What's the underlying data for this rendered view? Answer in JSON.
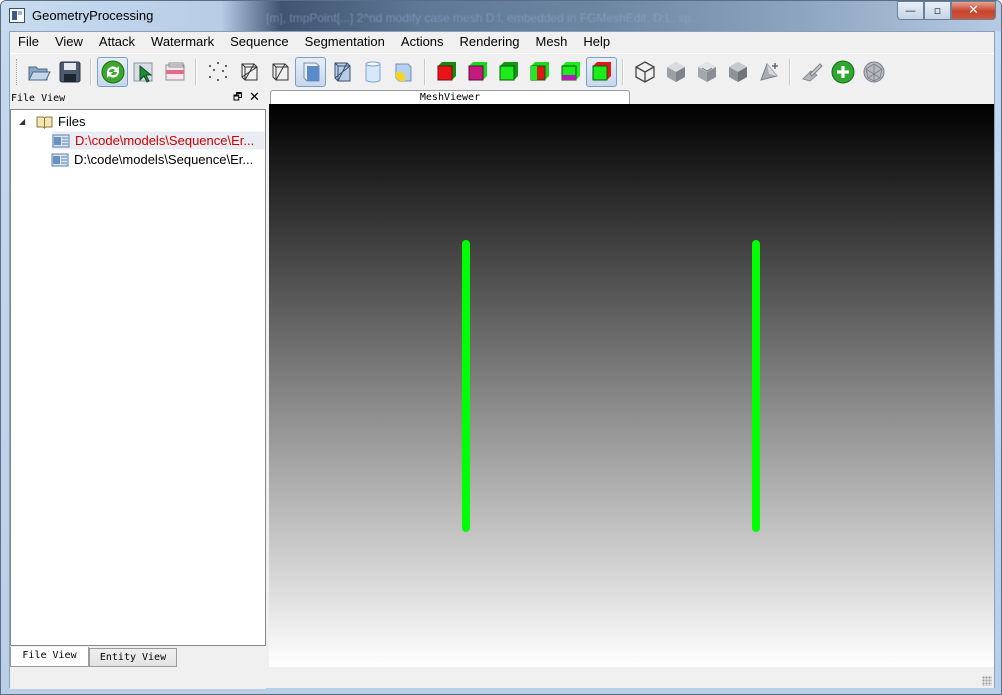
{
  "window": {
    "title": "GeometryProcessing",
    "background_text": "[m], tmpPoint[...] 2^nd modify case mesh D:l, embedded in FGMeshEdit, D:L, sp...",
    "minimize": "—",
    "maximize": "▫",
    "close": "✕"
  },
  "menu": [
    "File",
    "View",
    "Attack",
    "Watermark",
    "Sequence",
    "Segmentation",
    "Actions",
    "Rendering",
    "Mesh",
    "Help"
  ],
  "toolbar": {
    "buttons": [
      {
        "icon": "open-folder-icon"
      },
      {
        "icon": "save-disk-icon"
      },
      {
        "icon": "rotate-icon",
        "active": true
      },
      {
        "icon": "select-arrow-icon"
      },
      {
        "icon": "select-region-icon"
      },
      {
        "icon": "points-render-icon"
      },
      {
        "icon": "wireframe-render-icon"
      },
      {
        "icon": "hidden-line-render-icon"
      },
      {
        "icon": "flat-shading-icon",
        "active": true
      },
      {
        "icon": "flat-lines-icon"
      },
      {
        "icon": "smooth-shading-icon"
      },
      {
        "icon": "texture-shading-icon"
      },
      {
        "icon": "red-cube-icon"
      },
      {
        "icon": "magenta-cube-icon"
      },
      {
        "icon": "green-cube-icon"
      },
      {
        "icon": "red-green-cube-icon"
      },
      {
        "icon": "green-magenta-cube-icon"
      },
      {
        "icon": "green-red-cube-icon",
        "active": true
      },
      {
        "icon": "cube-outline-icon"
      },
      {
        "icon": "cube-gray-icon"
      },
      {
        "icon": "cube-gray-dent-icon"
      },
      {
        "icon": "cube-solid-gray-icon"
      },
      {
        "icon": "cube-plus-icon"
      },
      {
        "icon": "mesh-pencil-icon"
      },
      {
        "icon": "add-circle-icon"
      },
      {
        "icon": "sphere-mesh-icon"
      }
    ]
  },
  "dock": {
    "title": "File View",
    "float_button": "🗗",
    "close_button": "✕",
    "tree": {
      "root_label": "Files",
      "items": [
        {
          "label": "D:\\code\\models\\Sequence\\Er...",
          "selected": true,
          "color": "#cc0000"
        },
        {
          "label": "D:\\code\\models\\Sequence\\Er...",
          "selected": false,
          "color": "#000000"
        }
      ]
    },
    "tabs": [
      "File View",
      "Entity View"
    ]
  },
  "viewer": {
    "tab_label": "MeshViewer",
    "line_color": "#00ff00"
  }
}
